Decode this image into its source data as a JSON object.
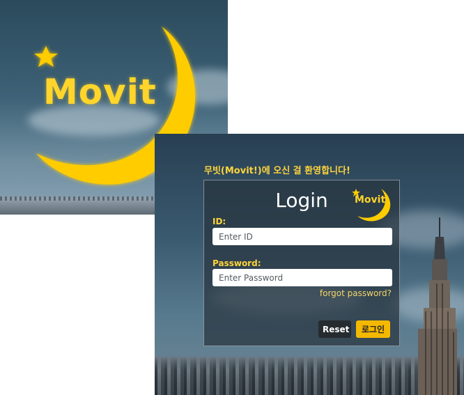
{
  "preview": {
    "logo_text": "Movit"
  },
  "login": {
    "welcome": "무빗(Movit!)에 오신 걸 환영합니다!",
    "title": "Login",
    "logo_text": "Movit",
    "id_label": "ID:",
    "id_placeholder": "Enter ID",
    "password_label": "Password:",
    "password_placeholder": "Enter Password",
    "forgot_label": "forgot password?",
    "reset_label": "Reset",
    "login_label": "로그인"
  },
  "colors": {
    "accent": "#ffd43b",
    "login_button": "#f5b800",
    "reset_button": "#262b30"
  }
}
